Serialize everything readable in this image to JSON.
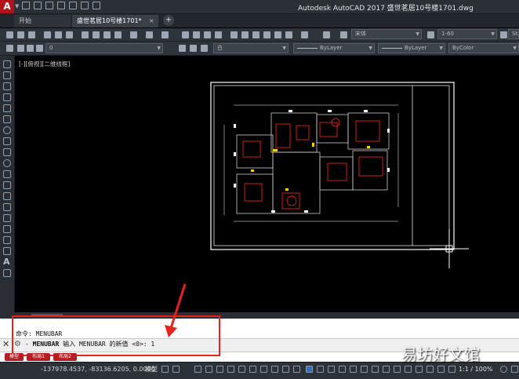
{
  "app": {
    "logo_letter": "A",
    "title": "Autodesk AutoCAD 2017    盛世茗居10号楼1701.dwg"
  },
  "tabs": [
    {
      "label": "开始"
    },
    {
      "label": "盛世茗居10号楼1701*"
    }
  ],
  "tab_add_label": "+",
  "tab_close_label": "×",
  "toolbar1": {
    "font_value": "宋体",
    "dimstyle_value": "1-60",
    "style_value": "Star"
  },
  "toolbar2": {
    "layer_value": "0",
    "layer_color_value": "白",
    "linetype_value": "ByLayer",
    "lineweight_value": "ByLayer",
    "plotstyle_value": "ByColor"
  },
  "viewport_label": "[-][俯视][二维线框]",
  "command": {
    "history": "命令: MENUBAR",
    "prompt_cmd": "MENUBAR",
    "prompt_rest": " 输入 MENUBAR 的新值 <0>: ",
    "input_value": "1"
  },
  "status": {
    "coords": "-137978.4537, -83136.6205, 0.0000",
    "model_label": "模型",
    "scale": "1:1 / 100%"
  },
  "layout_tabs": [
    "模型",
    "布局1",
    "布局2"
  ],
  "watermark": "易坊好文馆",
  "colors": {
    "accent_red": "#e8211a",
    "title_bg": "#2b2f36",
    "canvas_bg": "#000000",
    "command_bg": "#ffffff"
  }
}
